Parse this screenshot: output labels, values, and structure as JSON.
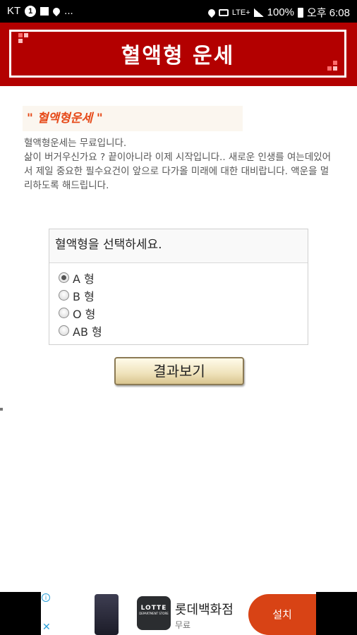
{
  "status_bar": {
    "carrier": "KT",
    "notification_count": "1",
    "overflow": "...",
    "network": "LTE+",
    "battery": "100%",
    "time": "오후 6:08"
  },
  "header": {
    "title": "혈액형 운세",
    "background": "#b30000"
  },
  "intro": {
    "title": "\" 혈액형운세 \"",
    "lines": [
      "혈액형운세는 무료입니다.",
      "삶이 버거우신가요 ? 끝이아니라 이제 시작입니다.. 새로운 인생를 여는데있어서 제일 중요한 필수요건이 앞으로 다가올 미래에 대한 대비랍니다. 액운을 멀리하도록 해드립니다."
    ]
  },
  "blood_form": {
    "prompt": "혈액형을 선택하세요.",
    "options": [
      {
        "label": "A 형",
        "checked": true
      },
      {
        "label": "B 형",
        "checked": false
      },
      {
        "label": "O 형",
        "checked": false
      },
      {
        "label": "AB 형",
        "checked": false
      }
    ],
    "submit_label": "결과보기"
  },
  "ad": {
    "brand_logo_text": "LOTTE",
    "brand_logo_sub": "DEPARTMENT STORE",
    "app_name": "롯데백화점",
    "price": "무료",
    "install_label": "설치",
    "install_color": "#d84315"
  }
}
